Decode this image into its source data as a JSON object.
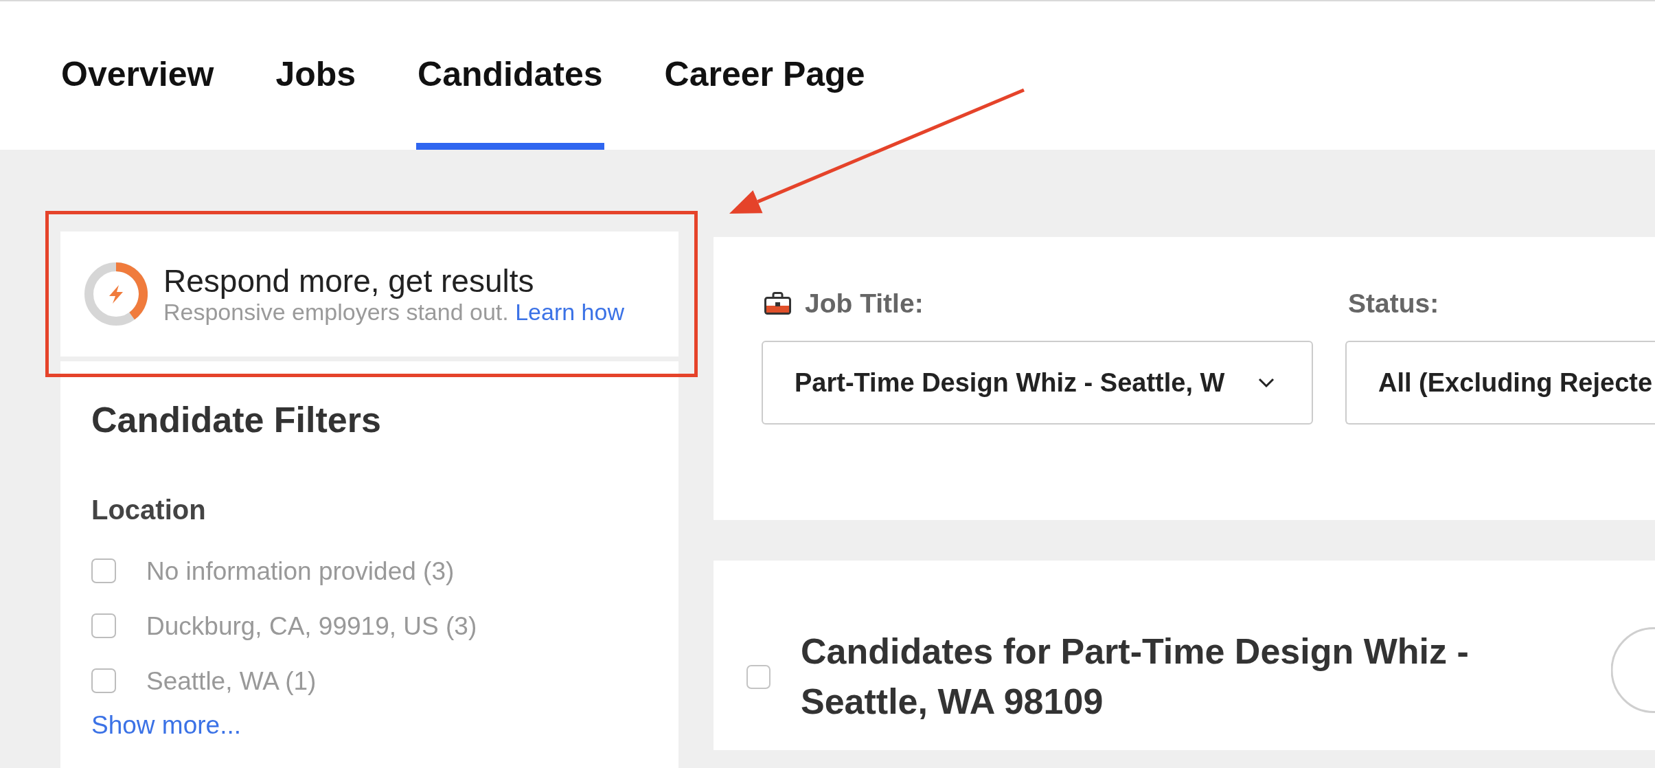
{
  "tabs": [
    {
      "label": "Overview",
      "selected": false
    },
    {
      "label": "Jobs",
      "selected": false
    },
    {
      "label": "Candidates",
      "selected": true
    },
    {
      "label": "Career Page",
      "selected": false
    }
  ],
  "response_prompt": {
    "title": "Respond more, get results",
    "text": "Responsive employers stand out.",
    "link": "Learn how"
  },
  "candidate_filters": {
    "title": "Candidate Filters",
    "sections": [
      {
        "title": "Location",
        "options": [
          {
            "label": "No information provided (3)",
            "checked": false
          },
          {
            "label": "Duckburg, CA, 99919, US (3)",
            "checked": false
          },
          {
            "label": "Seattle, WA (1)",
            "checked": false
          }
        ],
        "show_more": "Show more..."
      }
    ]
  },
  "job_filters": {
    "fields": [
      {
        "kind": "job",
        "label": "Job Title:",
        "value": "Part-Time Design Whiz - Seattle, W"
      },
      {
        "kind": "status",
        "label": "Status:",
        "value": "All (Excluding Rejecte"
      }
    ]
  },
  "candidate_list": {
    "checked": false,
    "title": "Candidates for Part-Time Design Whiz - Seattle, WA 98109"
  }
}
